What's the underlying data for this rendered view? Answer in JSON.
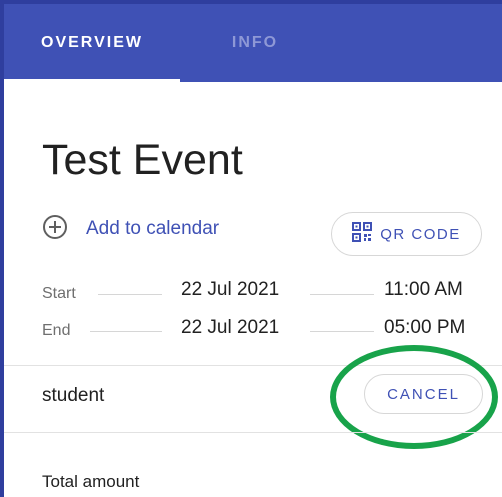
{
  "tabs": {
    "overview": "OVERVIEW",
    "info": "INFO"
  },
  "event": {
    "title": "Test Event",
    "add_to_calendar": "Add to calendar",
    "qr_code": "QR CODE",
    "start": {
      "label": "Start",
      "date": "22 Jul 2021",
      "time": "11:00 AM"
    },
    "end": {
      "label": "End",
      "date": "22 Jul 2021",
      "time": "05:00 PM"
    }
  },
  "ticket": {
    "type": "student",
    "cancel_label": "CANCEL"
  },
  "total": {
    "label": "Total amount"
  },
  "colors": {
    "primary": "#3f51b5",
    "highlight": "#18a34a"
  },
  "icons": {
    "add": "add-circle-icon",
    "qr": "qr-code-icon"
  }
}
